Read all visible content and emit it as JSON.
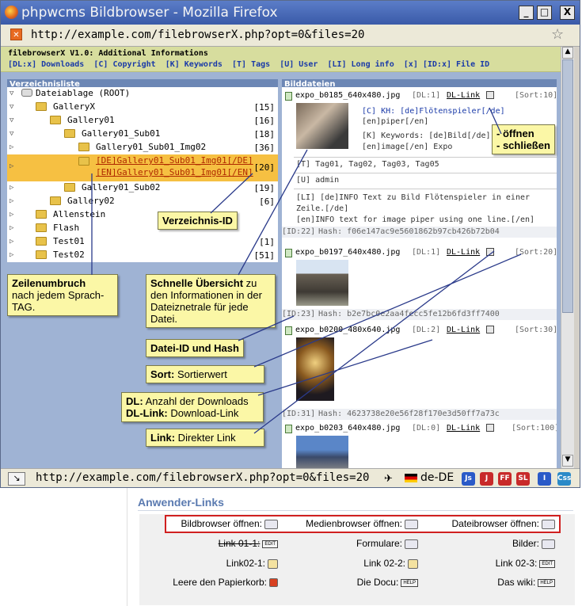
{
  "window": {
    "title": "phpwcms Bildbrowser - Mozilla Firefox",
    "min": "_",
    "max": "□",
    "close": "X"
  },
  "urlbar": {
    "url": "http://example.com/filebrowserX.php?opt=0&files=20"
  },
  "infobar": {
    "line1": "filebrowserX V1.0: Additional Informations",
    "items": [
      "[DL:x] Downloads",
      "[C] Copyright",
      "[K] Keywords",
      "[T] Tags",
      "[U] User",
      "[LI] Long info",
      "[x] [ID:x] File ID"
    ]
  },
  "tree": {
    "header": "Verzeichnisliste",
    "rows": [
      {
        "label": "Dateiablage (ROOT)",
        "count": ""
      },
      {
        "label": "GalleryX",
        "count": "[15]"
      },
      {
        "label": "Gallery01",
        "count": "[16]"
      },
      {
        "label": "Gallery01_Sub01",
        "count": "[18]"
      },
      {
        "label": "Gallery01_Sub01_Img02",
        "count": "[36]"
      },
      {
        "label": "[DE]Gallery01_Sub01_Img01[/DE]",
        "label2": "[EN]Gallery01_Sub01_Img01[/EN]",
        "count": "[20]"
      },
      {
        "label": "Gallery01_Sub02",
        "count": "[19]"
      },
      {
        "label": "Gallery02",
        "count": "[6]"
      },
      {
        "label": "Allenstein",
        "count": ""
      },
      {
        "label": "Flash",
        "count": ""
      },
      {
        "label": "Test01",
        "count": "[1]"
      },
      {
        "label": "Test02",
        "count": "[51]"
      }
    ]
  },
  "files": {
    "header": "Bilddateien",
    "f1": {
      "name": "expo_b0185_640x480.jpg",
      "dl": "[DL:1]",
      "dllink": "DL-Link",
      "sort": "[Sort:10]",
      "c1": "[C] KH: [de]Flötenspieler[/de]",
      "c2": "[en]piper[/en]",
      "k1": "[K] Keywords: [de]Bild[/de]",
      "k2": "[en]image[/en] Expo",
      "t": "[T] Tag01, Tag02, Tag03, Tag05",
      "u": "[U] admin",
      "li1": "[LI] [de]INFO Text zu Bild Flötenspieler in einer",
      "li2": "Zeile.[/de]",
      "li3": "[en]INFO text for image piper using one line.[/en]",
      "id": "[ID:22]",
      "hash": "Hash: f06e147ac9e5601862b97cb426b72b04"
    },
    "f2": {
      "name": "expo_b0197_640x480.jpg",
      "dl": "[DL:1]",
      "dllink": "DL-Link",
      "sort": "[Sort:20]",
      "id": "[ID:23]",
      "hash": "Hash: b2e7bc0e2aa4fecc5fe12b6fd3ff7400"
    },
    "f3": {
      "name": "expo_b0200_480x640.jpg",
      "dl": "[DL:2]",
      "dllink": "DL-Link",
      "sort": "[Sort:30]",
      "id": "[ID:31]",
      "hash": "Hash: 4623738e20e56f28f170e3d50ff7a73c"
    },
    "f4": {
      "name": "expo_b0203_640x480.jpg",
      "dl": "[DL:0]",
      "dllink": "DL-Link",
      "sort": "[Sort:100]"
    }
  },
  "status": {
    "url": "http://example.com/filebrowserX.php?opt=0&files=20",
    "lang": "de-DE",
    "icons": [
      "Js",
      "J",
      "FF",
      "SL",
      "I",
      "Css"
    ]
  },
  "callouts": {
    "open_close": "- öffnen\n- schließen",
    "verz_id": "Verzeichnis-ID",
    "zeilen_b": "Zeilenumbruch",
    "zeilen_t": "nach jedem Sprach-TAG.",
    "schnell_b": "Schnelle Übersicht",
    "schnell_t": " zu den Informationen in der Dateiznetrale für jede Datei.",
    "datei_id": "Datei-ID und Hash",
    "sort_b": "Sort:",
    "sort_t": " Sortierwert",
    "dl_b": "DL:",
    "dl_t": " Anzahl der Downloads",
    "dllink_b": "DL-Link:",
    "dllink_t": " Download-Link",
    "link_b": "Link:",
    "link_t": " Direkter Link"
  },
  "panel": {
    "title": "Anwender-Links",
    "rows": [
      [
        "Bildbrowser öffnen:",
        "Medienbrowser öffnen:",
        "Dateibrowser öffnen:"
      ],
      [
        "Link 01-1:",
        "Formulare:",
        "Bilder:"
      ],
      [
        "Link02-1:",
        "Link 02-2:",
        "Link 02-3:"
      ],
      [
        "Leere den Papierkorb:",
        "Die Docu:",
        "Das wiki:"
      ]
    ],
    "badges": {
      "edit": "EDIT",
      "help": "HELP"
    }
  }
}
